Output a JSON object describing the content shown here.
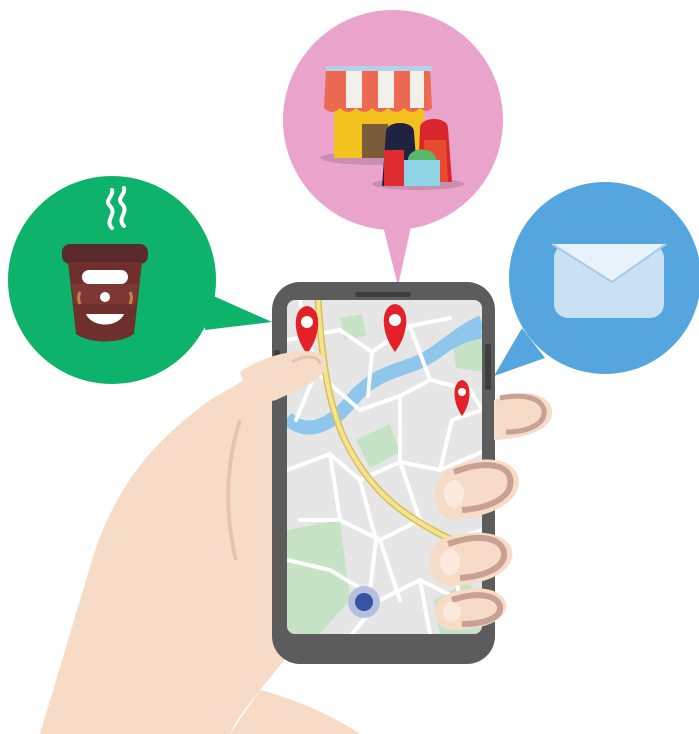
{
  "colors": {
    "coffee_bubble": "#0db36b",
    "shop_bubble": "#eaa4cb",
    "mail_bubble": "#55a5de",
    "phone_body": "#5d5c5c",
    "map_bg": "#e6e6e7",
    "map_road": "#ffffff",
    "map_route": "#f2df7e",
    "map_river": "#8ec6ec",
    "map_park": "#c7e3c6",
    "pin": "#e22128",
    "location_dot": "#3953a4",
    "skin": "#f6dcc7",
    "skin_shade": "#e8c3ab",
    "nail": "#c9a094"
  },
  "icons": {
    "coffee": "coffee-cup-icon",
    "shop": "shop-with-bags-icon",
    "mail": "envelope-icon",
    "pin": "map-pin-icon",
    "location": "current-location-icon"
  },
  "map": {
    "pin_count": 3
  }
}
